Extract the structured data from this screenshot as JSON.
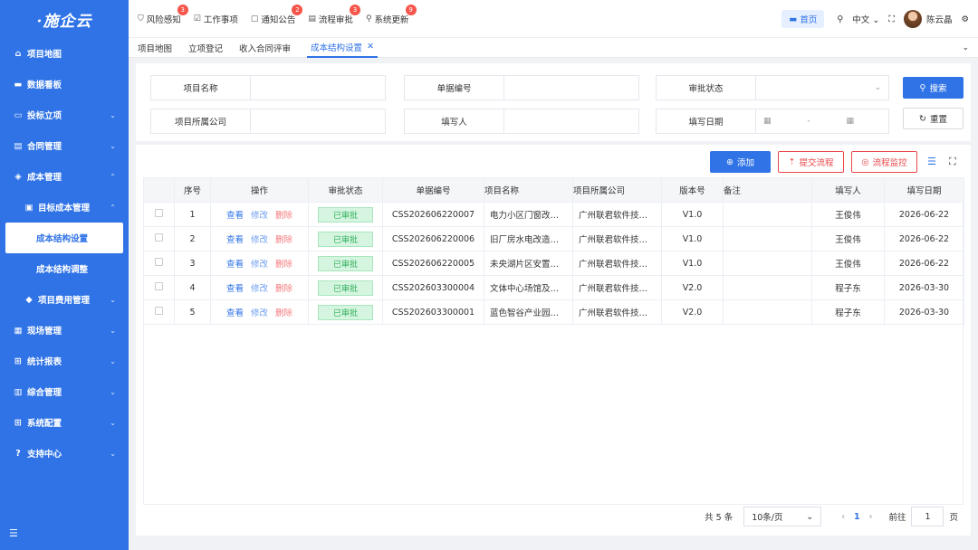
{
  "app": {
    "logo": "·施企云"
  },
  "sidebar": {
    "items": [
      {
        "label": "项目地图",
        "icon": "home-icon",
        "chev": ""
      },
      {
        "label": "数据看板",
        "icon": "monitor-icon",
        "chev": ""
      },
      {
        "label": "投标立项",
        "icon": "folder-icon",
        "chev": "⌄"
      },
      {
        "label": "合同管理",
        "icon": "contract-icon",
        "chev": "⌄"
      },
      {
        "label": "成本管理",
        "icon": "cost-icon",
        "chev": "⌃"
      },
      {
        "label": "目标成本管理",
        "icon": "target-icon",
        "chev": "⌃"
      },
      {
        "label": "成本结构设置",
        "icon": "",
        "chev": ""
      },
      {
        "label": "成本结构调整",
        "icon": "",
        "chev": ""
      },
      {
        "label": "项目费用管理",
        "icon": "fee-icon",
        "chev": "⌄"
      },
      {
        "label": "现场管理",
        "icon": "site-icon",
        "chev": "⌄"
      },
      {
        "label": "统计报表",
        "icon": "grid-icon",
        "chev": "⌄"
      },
      {
        "label": "综合管理",
        "icon": "manage-icon",
        "chev": "⌄"
      },
      {
        "label": "系统配置",
        "icon": "config-icon",
        "chev": "⌄"
      },
      {
        "label": "支持中心",
        "icon": "support-icon",
        "chev": "⌄"
      }
    ]
  },
  "topnav": [
    {
      "label": "风险感知",
      "badge": "3"
    },
    {
      "label": "工作事项",
      "badge": ""
    },
    {
      "label": "通知公告",
      "badge": "2"
    },
    {
      "label": "流程审批",
      "badge": "3"
    },
    {
      "label": "系统更新",
      "badge": "9"
    }
  ],
  "topright": {
    "home": "首页",
    "lang": "中文",
    "user": "陈云晶"
  },
  "tabs": [
    "项目地图",
    "立项登记",
    "收入合同评审",
    "成本结构设置"
  ],
  "search": {
    "project_name": "项目名称",
    "doc_no": "单据编号",
    "approve_status": "审批状态",
    "company": "项目所属公司",
    "filler": "填写人",
    "fill_date": "填写日期",
    "date_sep": "-",
    "search_btn": "搜索",
    "reset_btn": "重置"
  },
  "toolbar": {
    "add": "添加",
    "submit": "提交流程",
    "monitor": "流程监控"
  },
  "table": {
    "headers": [
      "序号",
      "操作",
      "审批状态",
      "单据编号",
      "项目名称",
      "项目所属公司",
      "版本号",
      "备注",
      "填写人",
      "填写日期"
    ],
    "ops": [
      "查看",
      "修改",
      "删除"
    ],
    "rows": [
      {
        "no": "1",
        "status": "已审批",
        "doc": "CSS202606220007",
        "name": "电力小区门窗改…",
        "company": "广州联君软件技…",
        "ver": "V1.0",
        "note": "",
        "filler": "王俊伟",
        "date": "2026-06-22"
      },
      {
        "no": "2",
        "status": "已审批",
        "doc": "CSS202606220006",
        "name": "旧厂房水电改造…",
        "company": "广州联君软件技…",
        "ver": "V1.0",
        "note": "",
        "filler": "王俊伟",
        "date": "2026-06-22"
      },
      {
        "no": "3",
        "status": "已审批",
        "doc": "CSS202606220005",
        "name": "未央湖片区安置…",
        "company": "广州联君软件技…",
        "ver": "V1.0",
        "note": "",
        "filler": "王俊伟",
        "date": "2026-06-22"
      },
      {
        "no": "4",
        "status": "已审批",
        "doc": "CSS202603300004",
        "name": "文体中心场馆及…",
        "company": "广州联君软件技…",
        "ver": "V2.0",
        "note": "",
        "filler": "程子东",
        "date": "2026-03-30"
      },
      {
        "no": "5",
        "status": "已审批",
        "doc": "CSS202603300001",
        "name": "蓝色智谷产业园…",
        "company": "广州联君软件技…",
        "ver": "V2.0",
        "note": "",
        "filler": "程子东",
        "date": "2026-03-30"
      }
    ]
  },
  "pager": {
    "total": "共 5 条",
    "size": "10条/页",
    "page": "1",
    "goto": "前往",
    "goto_val": "1",
    "unit": "页"
  }
}
